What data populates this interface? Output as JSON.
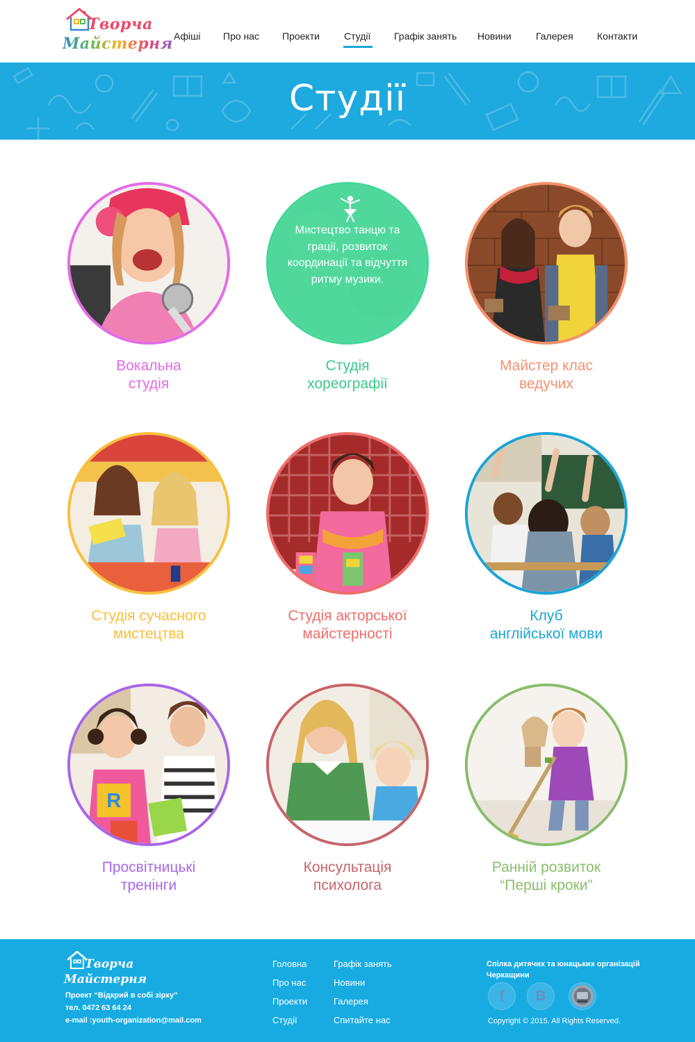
{
  "logo": {
    "line1": "Творча",
    "line2": "Майстерня"
  },
  "nav": {
    "items": [
      {
        "label": "Афіші"
      },
      {
        "label": "Про нас"
      },
      {
        "label": "Проекти"
      },
      {
        "label": "Студії"
      },
      {
        "label": "Графік занять"
      },
      {
        "label": "Новини"
      },
      {
        "label": "Галерея"
      },
      {
        "label": "Контакти"
      }
    ],
    "active_index": 3
  },
  "banner": {
    "title": "Студії"
  },
  "studios": [
    {
      "title_line1": "Вокальна",
      "title_line2": "студія",
      "color": "#e46be6"
    },
    {
      "title_line1": "Студія",
      "title_line2": "хореографії",
      "color": "#3bc889",
      "hover_text": "Мистецтво танцю та грації, розвиток координації та відчуття ритму музики."
    },
    {
      "title_line1": "Майстер клас",
      "title_line2": "ведучих",
      "color": "#f4916d"
    },
    {
      "title_line1": "Студія сучасного",
      "title_line2": "мистецтва",
      "color": "#f9bf3b"
    },
    {
      "title_line1": "Студія акторської",
      "title_line2": "майстерності",
      "color": "#ef6e6b"
    },
    {
      "title_line1": "Клуб",
      "title_line2": "англійської мови",
      "color": "#19a4d6"
    },
    {
      "title_line1": "Просвітницькі",
      "title_line2": "тренінги",
      "color": "#a867e6"
    },
    {
      "title_line1": "Консультація",
      "title_line2": "психолога",
      "color": "#c76469"
    },
    {
      "title_line1": "Ранній розвиток",
      "title_line2": "“Перші кроки”",
      "color": "#89bd6c"
    }
  ],
  "footer": {
    "logo": {
      "line1": "Творча",
      "line2": "Майстерня"
    },
    "project": "Проект “Відкрий в собі зірку”",
    "phone": "тел. 0472 63 64 24",
    "email": "e-mail :youth-organization@mail.com",
    "links_col1": [
      "Головна",
      "Про нас",
      "Проекти",
      "Студії"
    ],
    "links_col2": [
      "Графік занять",
      "Новини",
      "Галерея",
      "Спитайте нас"
    ],
    "org": "Спілка дитячих та юнацьких організацій Черкащини",
    "social": [
      {
        "icon": "facebook-icon",
        "glyph": "f"
      },
      {
        "icon": "vk-icon",
        "glyph": "В"
      },
      {
        "icon": "organization-logo-icon",
        "glyph": ""
      }
    ],
    "copyright": "Copyright © 2015.  All Rights Reserved."
  }
}
